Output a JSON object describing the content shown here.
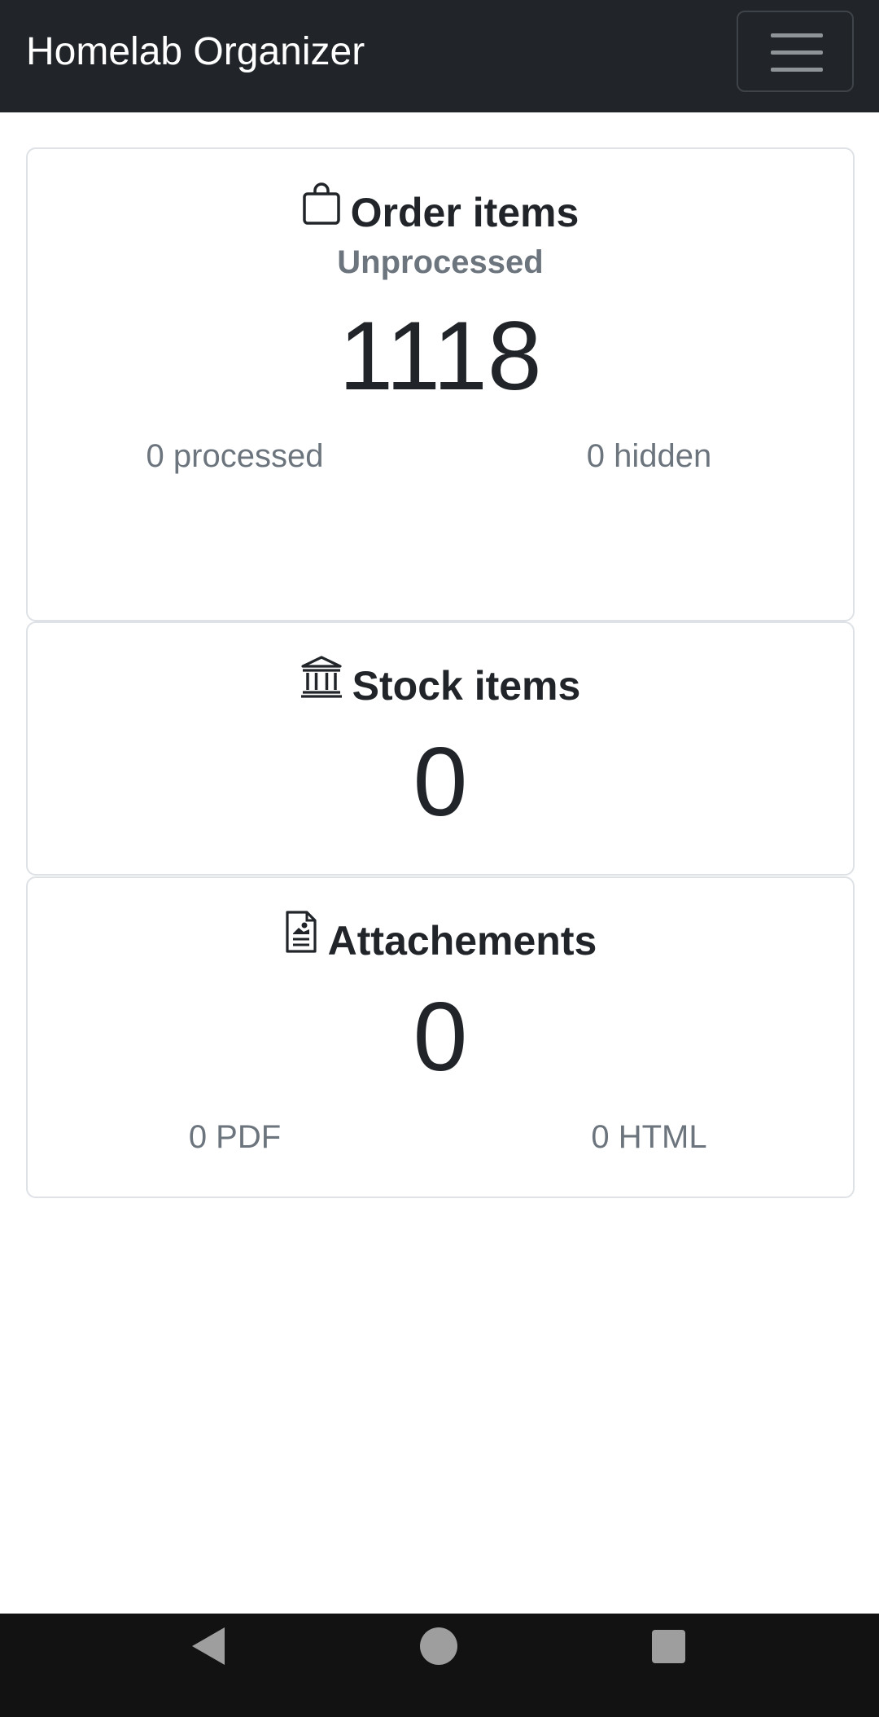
{
  "navbar": {
    "brand": "Homelab Organizer",
    "menu_icon": "hamburger-menu-icon"
  },
  "cards": {
    "orders": {
      "icon": "shopping-bag-icon",
      "title": "Order items",
      "subtitle": "Unprocessed",
      "count": "1118",
      "processed": "0 processed",
      "hidden": "0 hidden"
    },
    "stock": {
      "icon": "bank-building-icon",
      "title": "Stock items",
      "count": "0"
    },
    "attachments": {
      "icon": "file-richtext-icon",
      "title": "Attachements",
      "count": "0",
      "pdf": "0 PDF",
      "html": "0 HTML"
    }
  },
  "system_nav": {
    "back_icon": "back-triangle-icon",
    "home_icon": "home-circle-icon",
    "recents_icon": "recents-square-icon"
  },
  "colors": {
    "navbar_bg": "#212529",
    "text": "#212529",
    "muted": "#6c757d",
    "border": "#dee2e6",
    "system_nav_bg": "#121212"
  }
}
